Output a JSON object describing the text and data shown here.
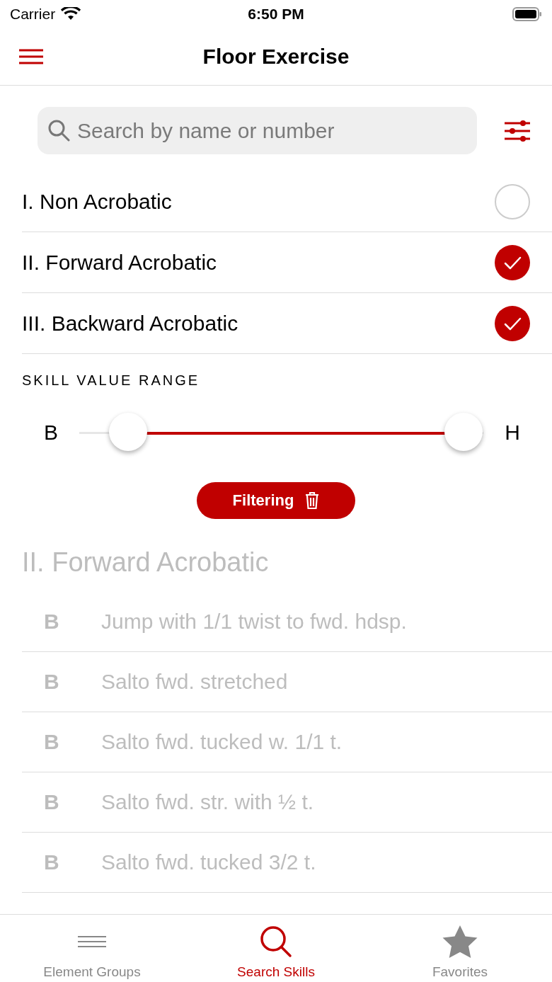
{
  "status_bar": {
    "carrier": "Carrier",
    "time": "6:50 PM"
  },
  "nav": {
    "title": "Floor Exercise"
  },
  "search": {
    "placeholder": "Search by name or number"
  },
  "categories": [
    {
      "label": "I. Non Acrobatic",
      "checked": false
    },
    {
      "label": "II. Forward Acrobatic",
      "checked": true
    },
    {
      "label": "III. Backward Acrobatic",
      "checked": true
    }
  ],
  "range": {
    "heading": "SKILL VALUE RANGE",
    "min_label": "B",
    "max_label": "H",
    "thumbs": [
      {
        "level": 0.12
      },
      {
        "level": 0.95
      }
    ]
  },
  "filter_button": {
    "label": "Filtering"
  },
  "skills": {
    "title": "II. Forward Acrobatic",
    "dimmed": true,
    "rows": [
      {
        "value": "B",
        "name": "Jump with 1/1 twist to fwd. hdsp."
      },
      {
        "value": "B",
        "name": "Salto fwd. stretched"
      },
      {
        "value": "B",
        "name": "Salto fwd. tucked w. 1/1 t."
      },
      {
        "value": "B",
        "name": "Salto fwd. str. with ½ t."
      },
      {
        "value": "B",
        "name": "Salto fwd. tucked 3/2 t."
      }
    ]
  },
  "tabs": [
    {
      "label": "Element Groups",
      "kind": "lines",
      "selected": false
    },
    {
      "label": "Search Skills",
      "kind": "search",
      "selected": true
    },
    {
      "label": "Favorites",
      "kind": "star",
      "selected": false
    }
  ]
}
